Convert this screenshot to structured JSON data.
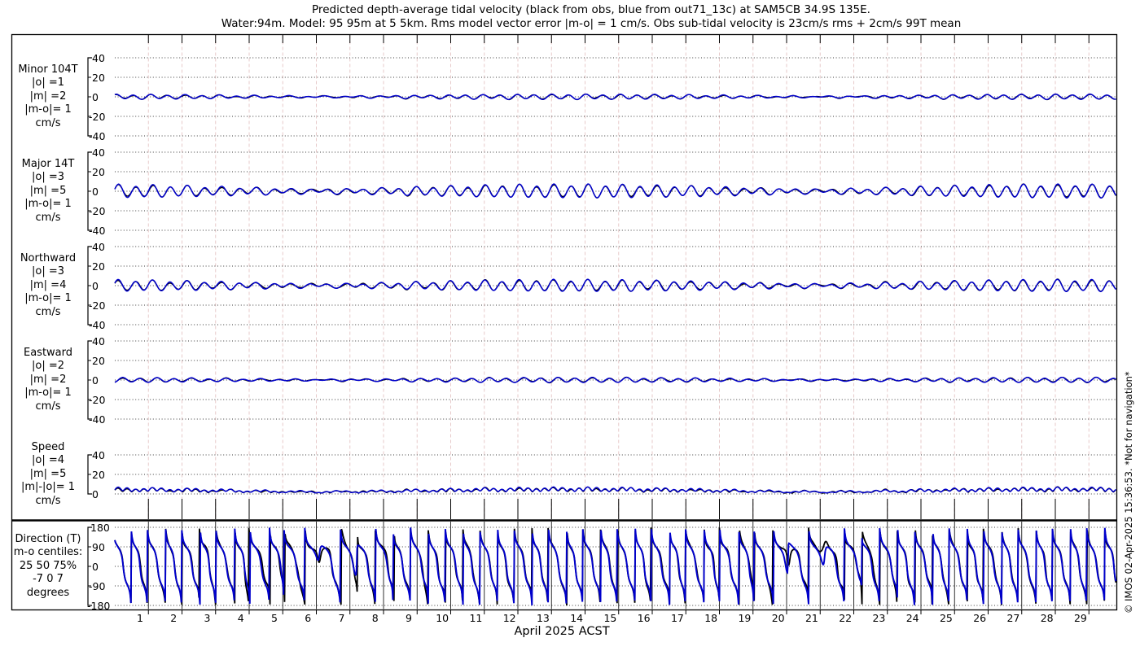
{
  "watermark": "© IMOS 02-Apr-2025 15:36:53. *Not for navigation*",
  "colors": {
    "model": "#0000cc",
    "obs": "#000000",
    "grid_dots": "#3a3a3a",
    "day_grid_upper": "#e7caca",
    "day_grid_lower": "#1a1a1a",
    "frame": "#000000"
  },
  "chart_data": {
    "type": "line",
    "title": "Predicted depth-average tidal velocity (black from obs, blue from out71_13c) at SAM5CB 34.9S 135E.",
    "subtitle": "Water:94m. Model: 95 95m at 5 5km. Rms model vector error |m-o| = 1 cm/s. Obs sub-tidal velocity is 23cm/s rms + 2cm/s 99T mean",
    "xlabel": "April 2025 ACST",
    "x_range_days": [
      0,
      29.82
    ],
    "day_labels": [
      "1",
      "2",
      "3",
      "4",
      "5",
      "6",
      "7",
      "8",
      "9",
      "10",
      "11",
      "12",
      "13",
      "14",
      "15",
      "16",
      "17",
      "18",
      "19",
      "20",
      "21",
      "22",
      "23",
      "24",
      "25",
      "26",
      "27",
      "28",
      "29"
    ],
    "legend": {
      "obs_label": "black from obs",
      "model_label": "blue from out71_13c",
      "obs_color": "#000000",
      "model_color": "#0000cc"
    },
    "sampling_dt_days": 0.015,
    "panels": [
      {
        "id": "minor",
        "label_lines": [
          "Minor 104T",
          "|o| =1",
          "|m| =2",
          "|m-o|= 1",
          "cm/s"
        ],
        "unit": "cm/s",
        "y_ticks": [
          40,
          20,
          0,
          -20,
          -40
        ],
        "y_range": [
          -40,
          40
        ],
        "model_components": [
          [
            1.5,
            0.5175,
            0.9
          ],
          [
            0.85,
            0.5,
            1.4
          ],
          [
            0.55,
            0.9973,
            0.5
          ]
        ],
        "obs_components": [
          [
            1.35,
            0.5175,
            0.85
          ],
          [
            0.8,
            0.5,
            1.45
          ],
          [
            0.5,
            0.9973,
            0.4
          ],
          [
            0.3,
            0.39,
            3.1
          ],
          [
            0.25,
            1.6,
            2.2
          ]
        ]
      },
      {
        "id": "major",
        "label_lines": [
          "Major 14T",
          "|o| =3",
          "|m| =5",
          "|m-o|= 1",
          "cm/s"
        ],
        "unit": "cm/s",
        "y_ticks": [
          40,
          20,
          0,
          -20,
          -40
        ],
        "y_range": [
          -40,
          40
        ],
        "model_components": [
          [
            4.2,
            0.5175,
            0.0
          ],
          [
            2.2,
            0.5,
            0.5
          ],
          [
            1.1,
            0.9973,
            1.0
          ]
        ],
        "obs_components": [
          [
            3.9,
            0.5175,
            -0.04
          ],
          [
            2.05,
            0.5,
            0.55
          ],
          [
            1.0,
            0.9973,
            0.9
          ],
          [
            0.45,
            0.43,
            2.2
          ],
          [
            0.35,
            1.9,
            0.7
          ]
        ]
      },
      {
        "id": "north",
        "label_lines": [
          "Northward",
          "|o| =3",
          "|m| =4",
          "|m-o|= 1",
          "cm/s"
        ],
        "unit": "cm/s",
        "y_ticks": [
          40,
          20,
          0,
          -20,
          -40
        ],
        "y_range": [
          -40,
          40
        ],
        "model_components": [
          [
            3.6,
            0.5175,
            0.15
          ],
          [
            1.9,
            0.5,
            0.65
          ],
          [
            1.0,
            0.9973,
            1.2
          ]
        ],
        "obs_components": [
          [
            3.35,
            0.5175,
            0.1
          ],
          [
            1.78,
            0.5,
            0.7
          ],
          [
            0.9,
            0.9973,
            1.1
          ],
          [
            0.45,
            0.37,
            2.0
          ],
          [
            0.4,
            1.7,
            5.0
          ]
        ]
      },
      {
        "id": "east",
        "label_lines": [
          "Eastward",
          "|o| =2",
          "|m| =2",
          "|m-o|= 1",
          "cm/s"
        ],
        "unit": "cm/s",
        "y_ticks": [
          40,
          20,
          0,
          -20,
          -40
        ],
        "y_range": [
          -40,
          40
        ],
        "model_components": [
          [
            1.5,
            0.5175,
            -1.45
          ],
          [
            0.8,
            0.5,
            -0.95
          ],
          [
            0.5,
            0.9973,
            -0.4
          ]
        ],
        "obs_components": [
          [
            1.4,
            0.5175,
            -1.5
          ],
          [
            0.75,
            0.5,
            -0.9
          ],
          [
            0.45,
            0.9973,
            -0.5
          ],
          [
            0.3,
            0.41,
            1.0
          ],
          [
            0.28,
            1.3,
            4.0
          ]
        ]
      },
      {
        "id": "speed",
        "label_lines": [
          "Speed",
          "|o| =4",
          "|m| =5",
          "|m|-|o|= 1",
          "cm/s"
        ],
        "unit": "cm/s",
        "y_ticks": [
          40,
          20,
          0
        ],
        "y_range": [
          0,
          40
        ],
        "derived": "speed",
        "from": [
          "north",
          "east"
        ],
        "floor_model": 0.7,
        "floor_obs": 0.65
      },
      {
        "id": "direction",
        "label_lines": [
          "Direction (T)",
          "m-o centiles:",
          "25  50  75%",
          "-7  0  7",
          "degrees"
        ],
        "unit": "degrees",
        "y_ticks": [
          180,
          90,
          0,
          -90,
          -180
        ],
        "y_range": [
          -180,
          180
        ],
        "derived": "direction",
        "from": [
          "north",
          "east"
        ],
        "mean_flow_model": [
          0.9,
          0.25
        ],
        "mean_flow_obs": [
          1.0,
          0.2
        ]
      }
    ]
  }
}
